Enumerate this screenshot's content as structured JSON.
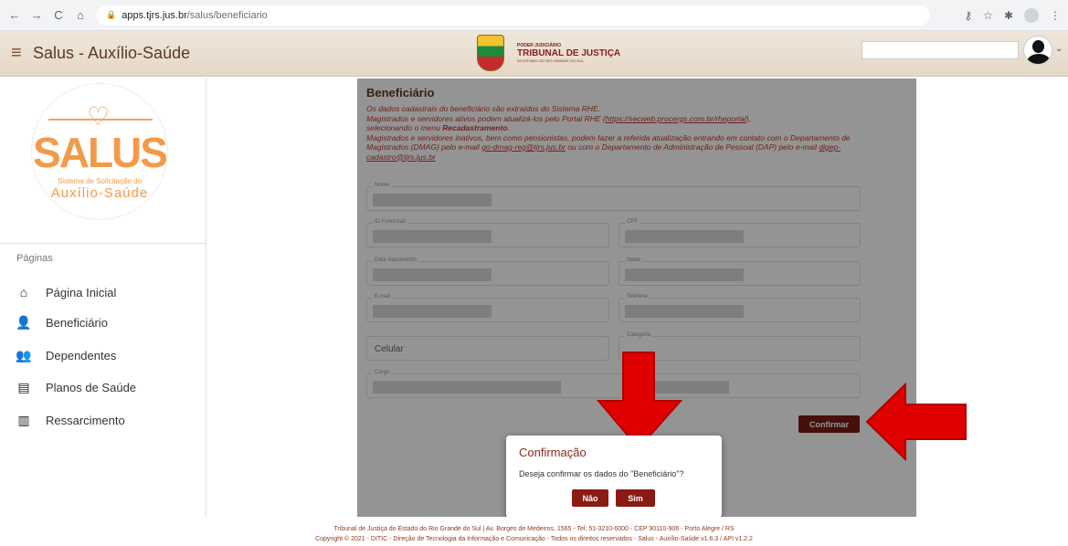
{
  "browser": {
    "url_host": "apps.tjrs.jus.br",
    "url_path": "/salus/beneficiario"
  },
  "header": {
    "app_title": "Salus - Auxílio-Saúde",
    "logo_small": "PODER JUDICIÁRIO",
    "logo_big": "TRIBUNAL DE JUSTIÇA",
    "logo_sub": "DO ESTADO DO RIO GRANDE DO SUL"
  },
  "sidebar": {
    "logo_title": "SALUS",
    "logo_sub1": "Sistema de Solicitação do",
    "logo_sub2": "Auxílio-Saúde",
    "section_label": "Páginas",
    "items": [
      {
        "label": "Página Inicial",
        "icon": "home-icon"
      },
      {
        "label": "Beneficiário",
        "icon": "person-icon"
      },
      {
        "label": "Dependentes",
        "icon": "people-icon"
      },
      {
        "label": "Planos de Saúde",
        "icon": "clipboard-icon"
      },
      {
        "label": "Ressarcimento",
        "icon": "receipt-icon"
      }
    ]
  },
  "form": {
    "title": "Beneficiário",
    "notice_1": "Os dados cadastrais do beneficiário são extraídos do Sistema RHE.",
    "notice_2a": "Magistrados e servidores ativos podem atualizá-los pelo Portal RHE (",
    "notice_2_link": "https://secweb.procergs.com.br/rheportal",
    "notice_2b": "),",
    "notice_3a": "selecionando o menu ",
    "notice_3_bold": "Recadastramento",
    "notice_3b": ".",
    "notice_4": "Magistrados e servidores inativos, bem como pensionistas, podem fazer a referida atualização entrando em contato com o Departamento de Magistrados (DMAG) pelo e-mail ",
    "notice_4_email": "go-dmag-reg@tjrs.jus.br",
    "notice_5": " ou com o Departamento de Administração de Pessoal (DAP) pelo e-mail ",
    "notice_5_email": "digep-cadastro@tjrs.jus.br",
    "fields": {
      "nome": "Nome",
      "id_funcional": "ID Funcional",
      "cpf": "CPF",
      "data_nascimento": "Data Nascimento",
      "idade": "Idade",
      "email": "E-mail",
      "telefone": "Telefone",
      "celular": "Celular",
      "categoria": "Categoria",
      "cargo": "Cargo"
    },
    "confirm_button": "Confirmar"
  },
  "modal": {
    "title": "Confirmação",
    "text": "Deseja confirmar os dados do \"Beneficiário\"?",
    "no_button": "Não",
    "yes_button": "Sim"
  },
  "footer": {
    "line1": "Tribunal de Justiça do Estado do Rio Grande do Sul | Av. Borges de Medeiros, 1565 - Tel: 51-3210-6000 - CEP 90110-906 - Porto Alegre / RS",
    "line2": "Copyright © 2021 - DITIC - Direção de Tecnologia da Informação e Comunicação - Todos os direitos reservados - Salus - Auxílio-Saúde v1.6.3 / API v1.2.2"
  },
  "colors": {
    "accent": "#7b1a14",
    "logo_orange": "#f39a4a",
    "arrow_red": "#e00000"
  }
}
